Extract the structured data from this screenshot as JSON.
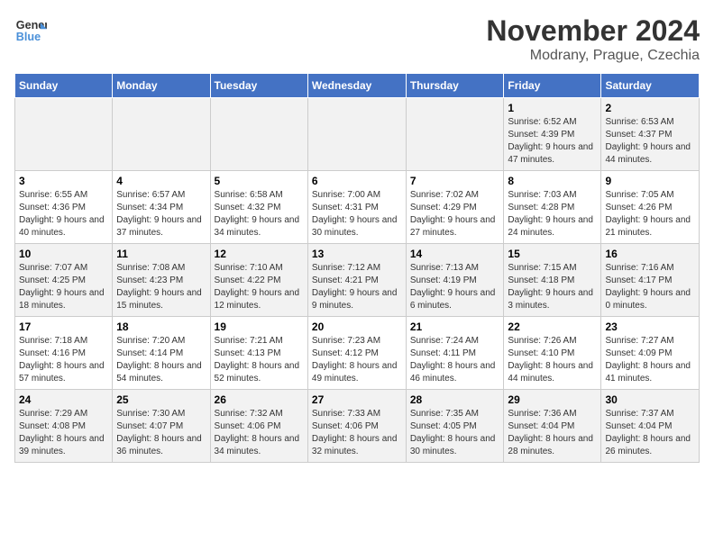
{
  "logo": {
    "line1": "General",
    "line2": "Blue"
  },
  "title": "November 2024",
  "subtitle": "Modrany, Prague, Czechia",
  "days_of_week": [
    "Sunday",
    "Monday",
    "Tuesday",
    "Wednesday",
    "Thursday",
    "Friday",
    "Saturday"
  ],
  "weeks": [
    [
      {
        "day": "",
        "info": ""
      },
      {
        "day": "",
        "info": ""
      },
      {
        "day": "",
        "info": ""
      },
      {
        "day": "",
        "info": ""
      },
      {
        "day": "",
        "info": ""
      },
      {
        "day": "1",
        "info": "Sunrise: 6:52 AM\nSunset: 4:39 PM\nDaylight: 9 hours and 47 minutes."
      },
      {
        "day": "2",
        "info": "Sunrise: 6:53 AM\nSunset: 4:37 PM\nDaylight: 9 hours and 44 minutes."
      }
    ],
    [
      {
        "day": "3",
        "info": "Sunrise: 6:55 AM\nSunset: 4:36 PM\nDaylight: 9 hours and 40 minutes."
      },
      {
        "day": "4",
        "info": "Sunrise: 6:57 AM\nSunset: 4:34 PM\nDaylight: 9 hours and 37 minutes."
      },
      {
        "day": "5",
        "info": "Sunrise: 6:58 AM\nSunset: 4:32 PM\nDaylight: 9 hours and 34 minutes."
      },
      {
        "day": "6",
        "info": "Sunrise: 7:00 AM\nSunset: 4:31 PM\nDaylight: 9 hours and 30 minutes."
      },
      {
        "day": "7",
        "info": "Sunrise: 7:02 AM\nSunset: 4:29 PM\nDaylight: 9 hours and 27 minutes."
      },
      {
        "day": "8",
        "info": "Sunrise: 7:03 AM\nSunset: 4:28 PM\nDaylight: 9 hours and 24 minutes."
      },
      {
        "day": "9",
        "info": "Sunrise: 7:05 AM\nSunset: 4:26 PM\nDaylight: 9 hours and 21 minutes."
      }
    ],
    [
      {
        "day": "10",
        "info": "Sunrise: 7:07 AM\nSunset: 4:25 PM\nDaylight: 9 hours and 18 minutes."
      },
      {
        "day": "11",
        "info": "Sunrise: 7:08 AM\nSunset: 4:23 PM\nDaylight: 9 hours and 15 minutes."
      },
      {
        "day": "12",
        "info": "Sunrise: 7:10 AM\nSunset: 4:22 PM\nDaylight: 9 hours and 12 minutes."
      },
      {
        "day": "13",
        "info": "Sunrise: 7:12 AM\nSunset: 4:21 PM\nDaylight: 9 hours and 9 minutes."
      },
      {
        "day": "14",
        "info": "Sunrise: 7:13 AM\nSunset: 4:19 PM\nDaylight: 9 hours and 6 minutes."
      },
      {
        "day": "15",
        "info": "Sunrise: 7:15 AM\nSunset: 4:18 PM\nDaylight: 9 hours and 3 minutes."
      },
      {
        "day": "16",
        "info": "Sunrise: 7:16 AM\nSunset: 4:17 PM\nDaylight: 9 hours and 0 minutes."
      }
    ],
    [
      {
        "day": "17",
        "info": "Sunrise: 7:18 AM\nSunset: 4:16 PM\nDaylight: 8 hours and 57 minutes."
      },
      {
        "day": "18",
        "info": "Sunrise: 7:20 AM\nSunset: 4:14 PM\nDaylight: 8 hours and 54 minutes."
      },
      {
        "day": "19",
        "info": "Sunrise: 7:21 AM\nSunset: 4:13 PM\nDaylight: 8 hours and 52 minutes."
      },
      {
        "day": "20",
        "info": "Sunrise: 7:23 AM\nSunset: 4:12 PM\nDaylight: 8 hours and 49 minutes."
      },
      {
        "day": "21",
        "info": "Sunrise: 7:24 AM\nSunset: 4:11 PM\nDaylight: 8 hours and 46 minutes."
      },
      {
        "day": "22",
        "info": "Sunrise: 7:26 AM\nSunset: 4:10 PM\nDaylight: 8 hours and 44 minutes."
      },
      {
        "day": "23",
        "info": "Sunrise: 7:27 AM\nSunset: 4:09 PM\nDaylight: 8 hours and 41 minutes."
      }
    ],
    [
      {
        "day": "24",
        "info": "Sunrise: 7:29 AM\nSunset: 4:08 PM\nDaylight: 8 hours and 39 minutes."
      },
      {
        "day": "25",
        "info": "Sunrise: 7:30 AM\nSunset: 4:07 PM\nDaylight: 8 hours and 36 minutes."
      },
      {
        "day": "26",
        "info": "Sunrise: 7:32 AM\nSunset: 4:06 PM\nDaylight: 8 hours and 34 minutes."
      },
      {
        "day": "27",
        "info": "Sunrise: 7:33 AM\nSunset: 4:06 PM\nDaylight: 8 hours and 32 minutes."
      },
      {
        "day": "28",
        "info": "Sunrise: 7:35 AM\nSunset: 4:05 PM\nDaylight: 8 hours and 30 minutes."
      },
      {
        "day": "29",
        "info": "Sunrise: 7:36 AM\nSunset: 4:04 PM\nDaylight: 8 hours and 28 minutes."
      },
      {
        "day": "30",
        "info": "Sunrise: 7:37 AM\nSunset: 4:04 PM\nDaylight: 8 hours and 26 minutes."
      }
    ]
  ]
}
